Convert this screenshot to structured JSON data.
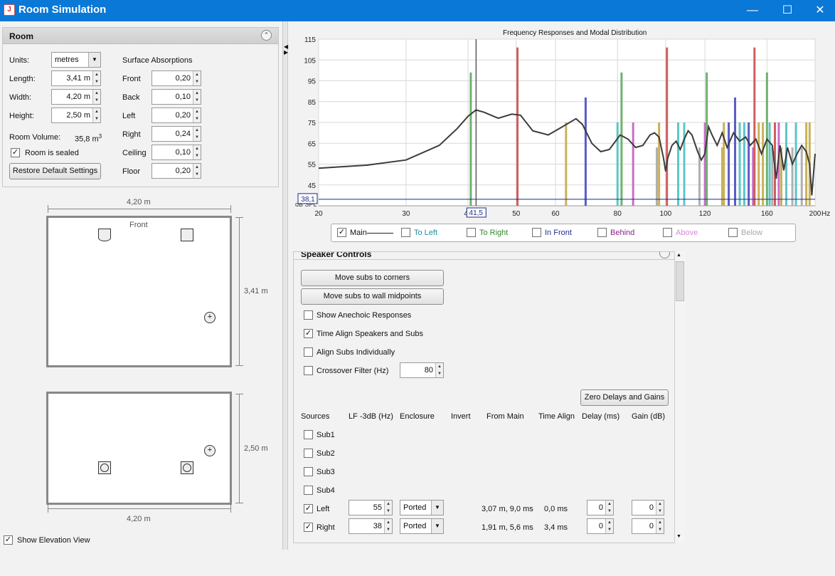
{
  "window": {
    "title": "Room Simulation",
    "minimize": "—",
    "maximize": "☐",
    "close": "✕"
  },
  "room": {
    "header": "Room",
    "units_label": "Units:",
    "units_value": "metres",
    "length_label": "Length:",
    "length_value": "3,41 m",
    "width_label": "Width:",
    "width_value": "4,20 m",
    "height_label": "Height:",
    "height_value": "2,50 m",
    "volume_label": "Room Volume:",
    "volume_value": "35,8 m",
    "volume_sup": "3",
    "sealed_label": "Room is sealed",
    "restore_label": "Restore Default Settings",
    "absorptions_title": "Surface Absorptions",
    "surfaces": [
      {
        "label": "Front",
        "value": "0,20"
      },
      {
        "label": "Back",
        "value": "0,10"
      },
      {
        "label": "Left",
        "value": "0,20"
      },
      {
        "label": "Right",
        "value": "0,24"
      },
      {
        "label": "Ceiling",
        "value": "0,10"
      },
      {
        "label": "Floor",
        "value": "0,20"
      }
    ]
  },
  "plan": {
    "width_top": "4,20 m",
    "front": "Front",
    "depth": "3,41 m",
    "height_side": "2,50 m",
    "width_bottom": "4,20 m",
    "elevation_label": "Show Elevation View"
  },
  "chart_data": {
    "type": "line",
    "title": "Frequency Responses and Modal Distribution",
    "x_unit": "Hz",
    "y_unit": "dB SPL",
    "xlim": [
      20,
      200
    ],
    "ylim": [
      35,
      115
    ],
    "x_scale": "log",
    "grid": true,
    "x_ticks": [
      "20",
      "30",
      "40",
      "50",
      "60",
      "80",
      "100",
      "120",
      "160",
      "200"
    ],
    "y_ticks": [
      "115",
      "105",
      "95",
      "85",
      "75",
      "65",
      "55",
      "45"
    ],
    "cursor_x": "41,5",
    "cursor_y": "38,1",
    "series": [
      {
        "name": "Main",
        "color": "#3c3c3c",
        "points": [
          [
            20,
            53
          ],
          [
            25,
            54.5
          ],
          [
            30,
            57
          ],
          [
            35,
            64
          ],
          [
            38,
            72
          ],
          [
            40,
            78
          ],
          [
            41.5,
            81
          ],
          [
            43,
            80
          ],
          [
            46,
            77
          ],
          [
            49,
            79
          ],
          [
            51,
            78.5
          ],
          [
            54,
            71
          ],
          [
            58,
            69
          ],
          [
            62,
            73
          ],
          [
            66,
            76.8
          ],
          [
            68,
            74
          ],
          [
            71,
            65
          ],
          [
            74,
            61
          ],
          [
            77,
            62
          ],
          [
            81,
            69
          ],
          [
            84,
            67
          ],
          [
            87,
            63
          ],
          [
            90,
            64
          ],
          [
            93,
            69
          ],
          [
            95,
            70
          ],
          [
            97,
            68
          ],
          [
            99,
            58
          ],
          [
            100,
            51.5
          ],
          [
            101,
            58
          ],
          [
            103,
            64
          ],
          [
            105,
            66
          ],
          [
            107,
            62
          ],
          [
            109,
            67
          ],
          [
            111,
            71
          ],
          [
            113,
            69
          ],
          [
            116,
            61
          ],
          [
            118,
            57
          ],
          [
            120,
            60
          ],
          [
            122,
            73
          ],
          [
            124,
            69
          ],
          [
            127,
            64
          ],
          [
            130,
            70
          ],
          [
            133,
            63
          ],
          [
            137,
            70
          ],
          [
            141,
            66
          ],
          [
            145,
            68
          ],
          [
            148,
            64
          ],
          [
            152,
            67
          ],
          [
            156,
            60
          ],
          [
            160,
            67
          ],
          [
            164,
            64
          ],
          [
            167,
            48
          ],
          [
            170,
            64
          ],
          [
            173,
            52
          ],
          [
            176,
            63
          ],
          [
            180,
            55
          ],
          [
            184,
            60
          ],
          [
            188,
            64
          ],
          [
            192,
            61
          ],
          [
            195,
            55
          ],
          [
            197,
            40
          ],
          [
            200,
            60
          ]
        ]
      }
    ],
    "modes": [
      {
        "f": 40.5,
        "top": 99,
        "color": "#6fb26f"
      },
      {
        "f": 50.3,
        "top": 111,
        "color": "#d05e5e"
      },
      {
        "f": 63,
        "top": 75,
        "color": "#c9b15a"
      },
      {
        "f": 69,
        "top": 87,
        "color": "#5b5bc6"
      },
      {
        "f": 80,
        "top": 75,
        "color": "#5cc6c6"
      },
      {
        "f": 81.5,
        "top": 99,
        "color": "#6fb26f"
      },
      {
        "f": 86,
        "top": 75,
        "color": "#c86ec8"
      },
      {
        "f": 96,
        "top": 63,
        "color": "#b0b0b0"
      },
      {
        "f": 97,
        "top": 75,
        "color": "#c9b15a"
      },
      {
        "f": 100.6,
        "top": 111,
        "color": "#d05e5e"
      },
      {
        "f": 106,
        "top": 75,
        "color": "#5cc6c6"
      },
      {
        "f": 109,
        "top": 75,
        "color": "#5cc6c6"
      },
      {
        "f": 117,
        "top": 63,
        "color": "#b0b0b0"
      },
      {
        "f": 120,
        "top": 75,
        "color": "#c86ec8"
      },
      {
        "f": 121,
        "top": 99,
        "color": "#6fb26f"
      },
      {
        "f": 130,
        "top": 63,
        "color": "#c9b15a"
      },
      {
        "f": 131,
        "top": 75,
        "color": "#c9b15a"
      },
      {
        "f": 134,
        "top": 75,
        "color": "#5b5bc6"
      },
      {
        "f": 138,
        "top": 87,
        "color": "#5b5bc6"
      },
      {
        "f": 141,
        "top": 75,
        "color": "#5cc6c6"
      },
      {
        "f": 144,
        "top": 75,
        "color": "#5cc6c6"
      },
      {
        "f": 147,
        "top": 75,
        "color": "#5b5bc6"
      },
      {
        "f": 150,
        "top": 63,
        "color": "#c86ec8"
      },
      {
        "f": 151,
        "top": 111,
        "color": "#d05e5e"
      },
      {
        "f": 154,
        "top": 75,
        "color": "#c9b15a"
      },
      {
        "f": 157,
        "top": 75,
        "color": "#c9b15a"
      },
      {
        "f": 160,
        "top": 99,
        "color": "#6fb26f"
      },
      {
        "f": 162,
        "top": 75,
        "color": "#5cc6c6"
      },
      {
        "f": 164,
        "top": 63,
        "color": "#b0b0b0"
      },
      {
        "f": 166,
        "top": 75,
        "color": "#d05e5e"
      },
      {
        "f": 169,
        "top": 75,
        "color": "#c86ec8"
      },
      {
        "f": 171,
        "top": 63,
        "color": "#c9b15a"
      },
      {
        "f": 175,
        "top": 75,
        "color": "#5cc6c6"
      },
      {
        "f": 180,
        "top": 63,
        "color": "#b0b0b0"
      },
      {
        "f": 183,
        "top": 75,
        "color": "#5cc6c6"
      },
      {
        "f": 188,
        "top": 63,
        "color": "#b0b0b0"
      },
      {
        "f": 192,
        "top": 75,
        "color": "#c9b15a"
      },
      {
        "f": 195,
        "top": 75,
        "color": "#c9b15a"
      }
    ]
  },
  "legend": [
    {
      "label": "Main",
      "checked": true,
      "color": "#111111"
    },
    {
      "label": "To Left",
      "checked": false,
      "color": "#1f8f9a"
    },
    {
      "label": "To Right",
      "checked": false,
      "color": "#2e8b2e"
    },
    {
      "label": "In Front",
      "checked": false,
      "color": "#1f2f8f"
    },
    {
      "label": "Behind",
      "checked": false,
      "color": "#8a1f8a"
    },
    {
      "label": "Above",
      "checked": false,
      "color": "#d88ad8"
    },
    {
      "label": "Below",
      "checked": false,
      "color": "#a8a8a8"
    }
  ],
  "speaker": {
    "header": "Speaker Controls",
    "corners_btn": "Move subs to corners",
    "midpoints_btn": "Move subs to wall midpoints",
    "anechoic": "Show Anechoic Responses",
    "time_align": "Time Align Speakers and Subs",
    "align_subs": "Align Subs Individually",
    "crossover": "Crossover Filter (Hz)",
    "crossover_value": "80",
    "zero_btn": "Zero Delays and Gains",
    "cols": [
      "Sources",
      "LF -3dB (Hz)",
      "Enclosure",
      "Invert",
      "From Main",
      "Time Align",
      "Delay (ms)",
      "Gain (dB)"
    ],
    "subs": [
      "Sub1",
      "Sub2",
      "Sub3",
      "Sub4"
    ],
    "rows": [
      {
        "name": "Left",
        "lf": "55",
        "enclosure": "Ported",
        "from_main": "3,07 m, 9,0 ms",
        "time_align": "0,0 ms",
        "delay": "0",
        "gain": "0"
      },
      {
        "name": "Right",
        "lf": "38",
        "enclosure": "Ported",
        "from_main": "1,91 m, 5,6 ms",
        "time_align": "3,4 ms",
        "delay": "0",
        "gain": "0"
      }
    ]
  }
}
